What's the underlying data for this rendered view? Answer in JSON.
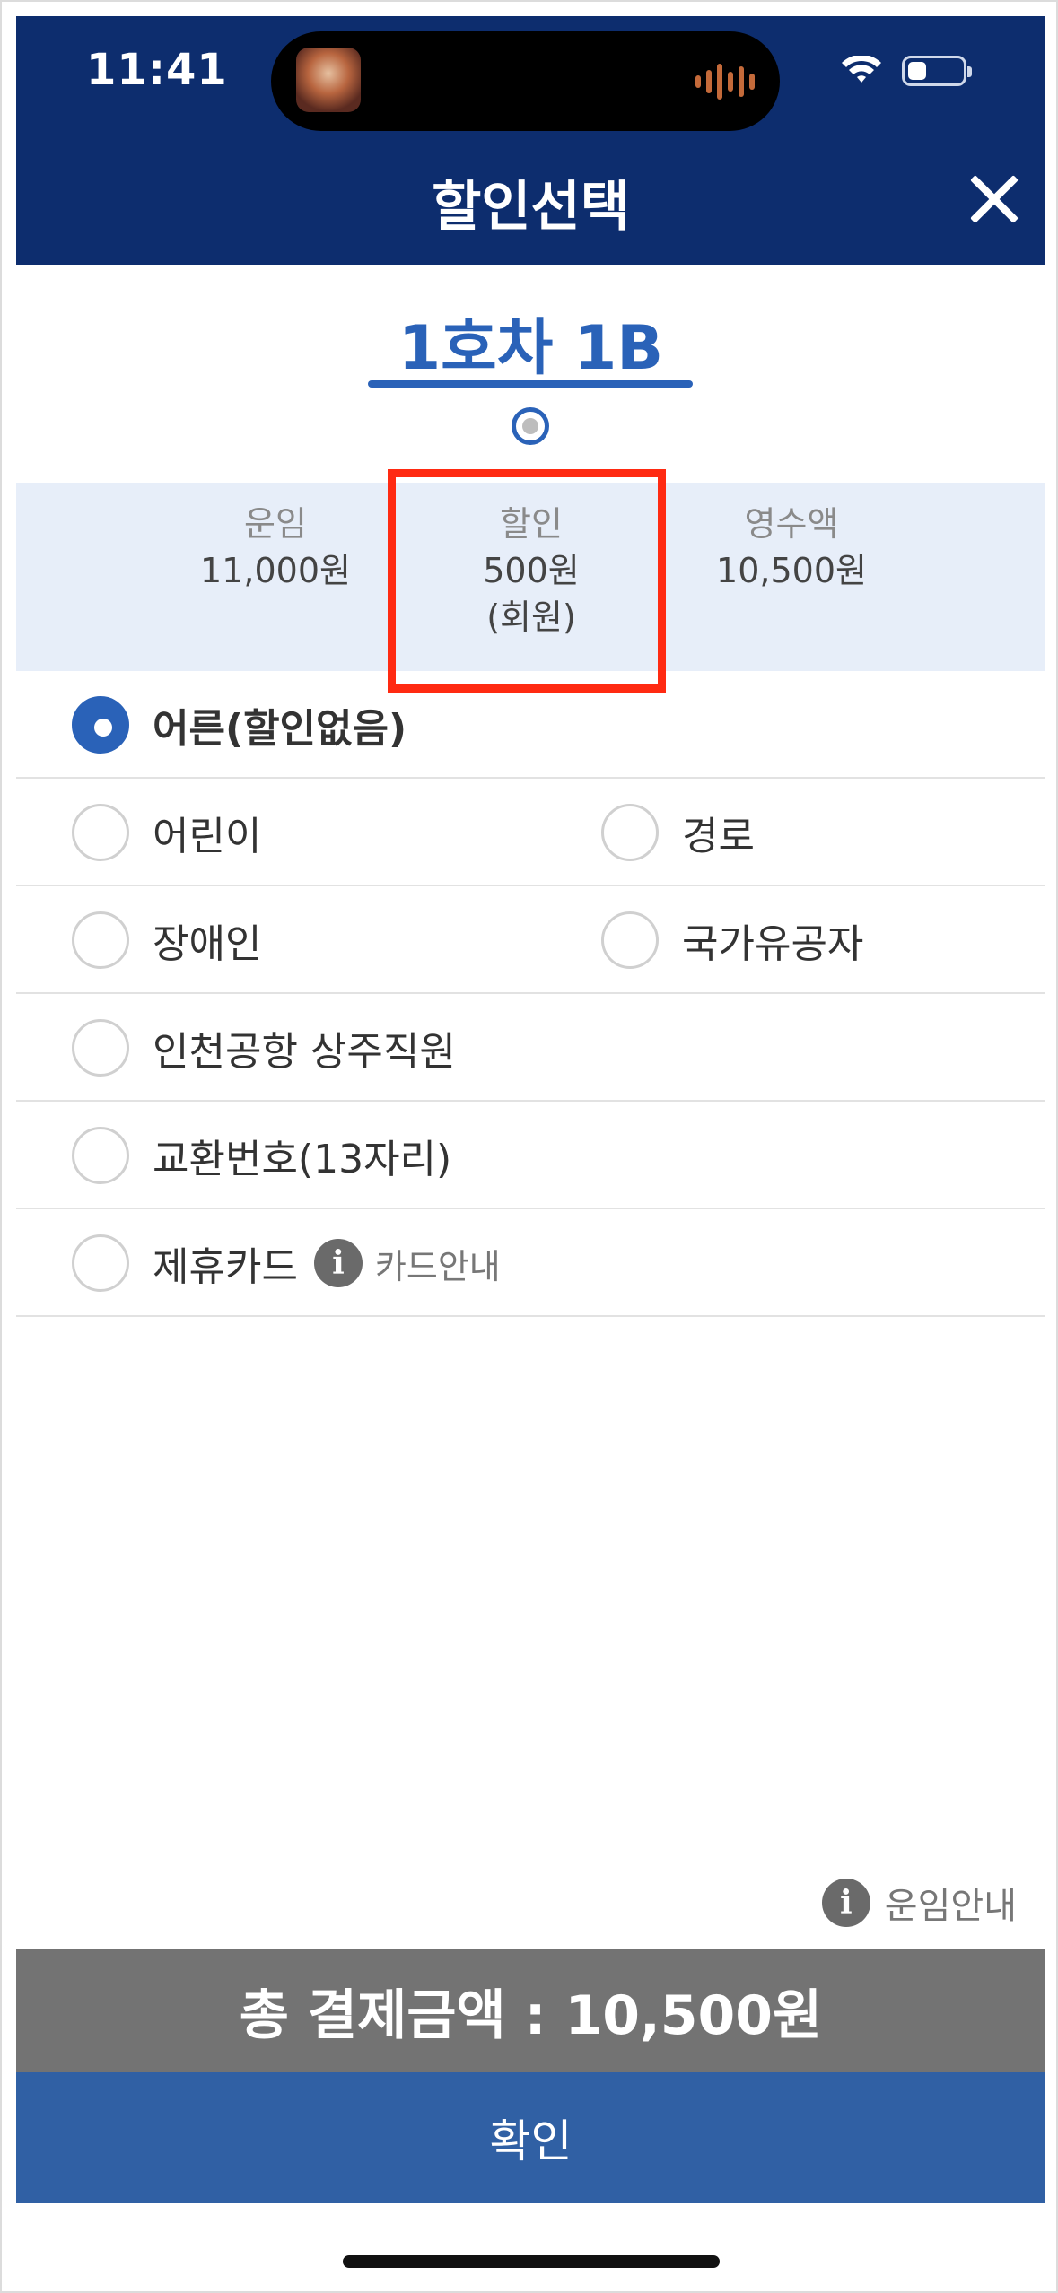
{
  "status_bar": {
    "time": "11:41"
  },
  "header": {
    "title": "할인선택"
  },
  "seat": {
    "label": "1호차 1B"
  },
  "summary": {
    "fare": {
      "label": "운임",
      "value": "11,000원"
    },
    "discount": {
      "label": "할인",
      "value": "500원",
      "note": "(회원)"
    },
    "receipt": {
      "label": "영수액",
      "value": "10,500원"
    }
  },
  "options": {
    "adult": "어른(할인없음)",
    "child": "어린이",
    "senior": "경로",
    "disabled": "장애인",
    "veteran": "국가유공자",
    "airport_staff": "인천공항 상주직원",
    "exchange": "교환번호(13자리)",
    "partner_card": "제휴카드",
    "card_guide": "카드안내"
  },
  "selected_option": "adult",
  "fare_guide": "운임안내",
  "total": "총 결제금액 : 10,500원",
  "confirm": "확인",
  "colors": {
    "header": "#0d2d6e",
    "accent": "#2a62b8",
    "summary_bg": "#e7eef9",
    "highlight": "#ff2a12",
    "total_bg": "#737373",
    "confirm_bg": "#3060a4"
  }
}
